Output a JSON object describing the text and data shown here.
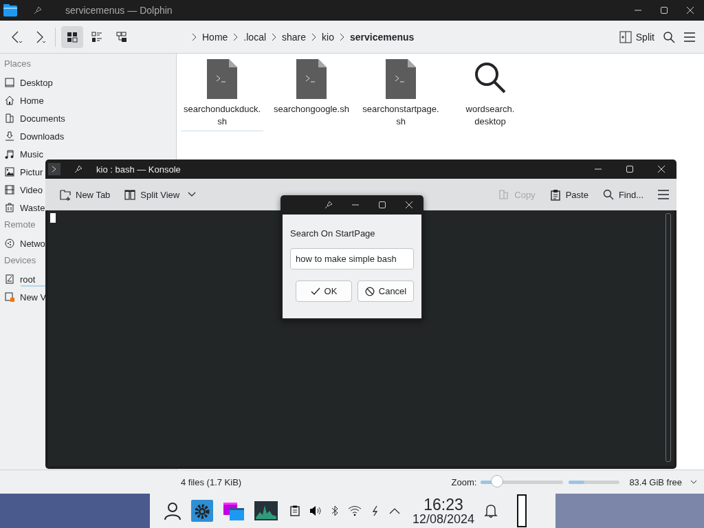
{
  "dolphin": {
    "title": "servicemenus — Dolphin",
    "view_modes": [
      {
        "kind": "icons",
        "selected": true
      },
      {
        "kind": "details",
        "selected": false
      },
      {
        "kind": "tree",
        "selected": false
      }
    ],
    "breadcrumb": [
      {
        "label": "Home",
        "current": false
      },
      {
        "label": ".local",
        "current": false
      },
      {
        "label": "share",
        "current": false
      },
      {
        "label": "kio",
        "current": false
      },
      {
        "label": "servicemenus",
        "current": true
      }
    ],
    "split_button": "Split",
    "sidebar": [
      {
        "heading": "Places",
        "items": [
          {
            "label": "Desktop",
            "kind": "desktop"
          },
          {
            "label": "Home",
            "kind": "home"
          },
          {
            "label": "Documents",
            "kind": "documents"
          },
          {
            "label": "Downloads",
            "kind": "downloads"
          },
          {
            "label": "Music",
            "kind": "music"
          },
          {
            "label": "Pictur",
            "kind": "pictures"
          },
          {
            "label": "Video",
            "kind": "videos"
          },
          {
            "label": "Waste",
            "kind": "trash"
          }
        ]
      },
      {
        "heading": "Remote",
        "items": [
          {
            "label": "Netwo",
            "kind": "network"
          }
        ]
      },
      {
        "heading": "Devices",
        "items": [
          {
            "label": "root",
            "kind": "drive"
          },
          {
            "label": "New V",
            "kind": "new-drive"
          }
        ]
      }
    ],
    "files": [
      {
        "name": "searchonduckduck.\nsh",
        "kind": "script",
        "selected": true
      },
      {
        "name": "searchongoogle.sh",
        "kind": "script",
        "selected": false
      },
      {
        "name": "searchonstartpage.\nsh",
        "kind": "script",
        "selected": false
      },
      {
        "name": "wordsearch.\ndesktop",
        "kind": "search",
        "selected": false
      }
    ],
    "status_bar": {
      "summary": "4 files (1.7 KiB)",
      "zoom_label": "Zoom:",
      "zoom": {
        "level": 0.2
      },
      "free_space": {
        "level": 0.3
      },
      "free_text": "83.4 GiB free"
    }
  },
  "konsole": {
    "title": "kio : bash — Konsole",
    "toolbar": [
      {
        "label": "New Tab",
        "kind": "new-tab",
        "disabled": false
      },
      {
        "label": "Split View",
        "kind": "split-view",
        "disabled": false
      },
      {
        "label": "Copy",
        "kind": "copy",
        "disabled": true
      },
      {
        "label": "Paste",
        "kind": "paste",
        "disabled": false
      },
      {
        "label": "Find...",
        "kind": "find",
        "disabled": false
      }
    ]
  },
  "dialog": {
    "label": "Search On StartPage",
    "input": {
      "value": "how to make simple bash"
    },
    "buttons": [
      {
        "label": "OK",
        "kind": "ok"
      },
      {
        "label": "Cancel",
        "kind": "cancel"
      }
    ]
  },
  "taskbar": {
    "time": "16:23",
    "date": "12/08/2024"
  }
}
